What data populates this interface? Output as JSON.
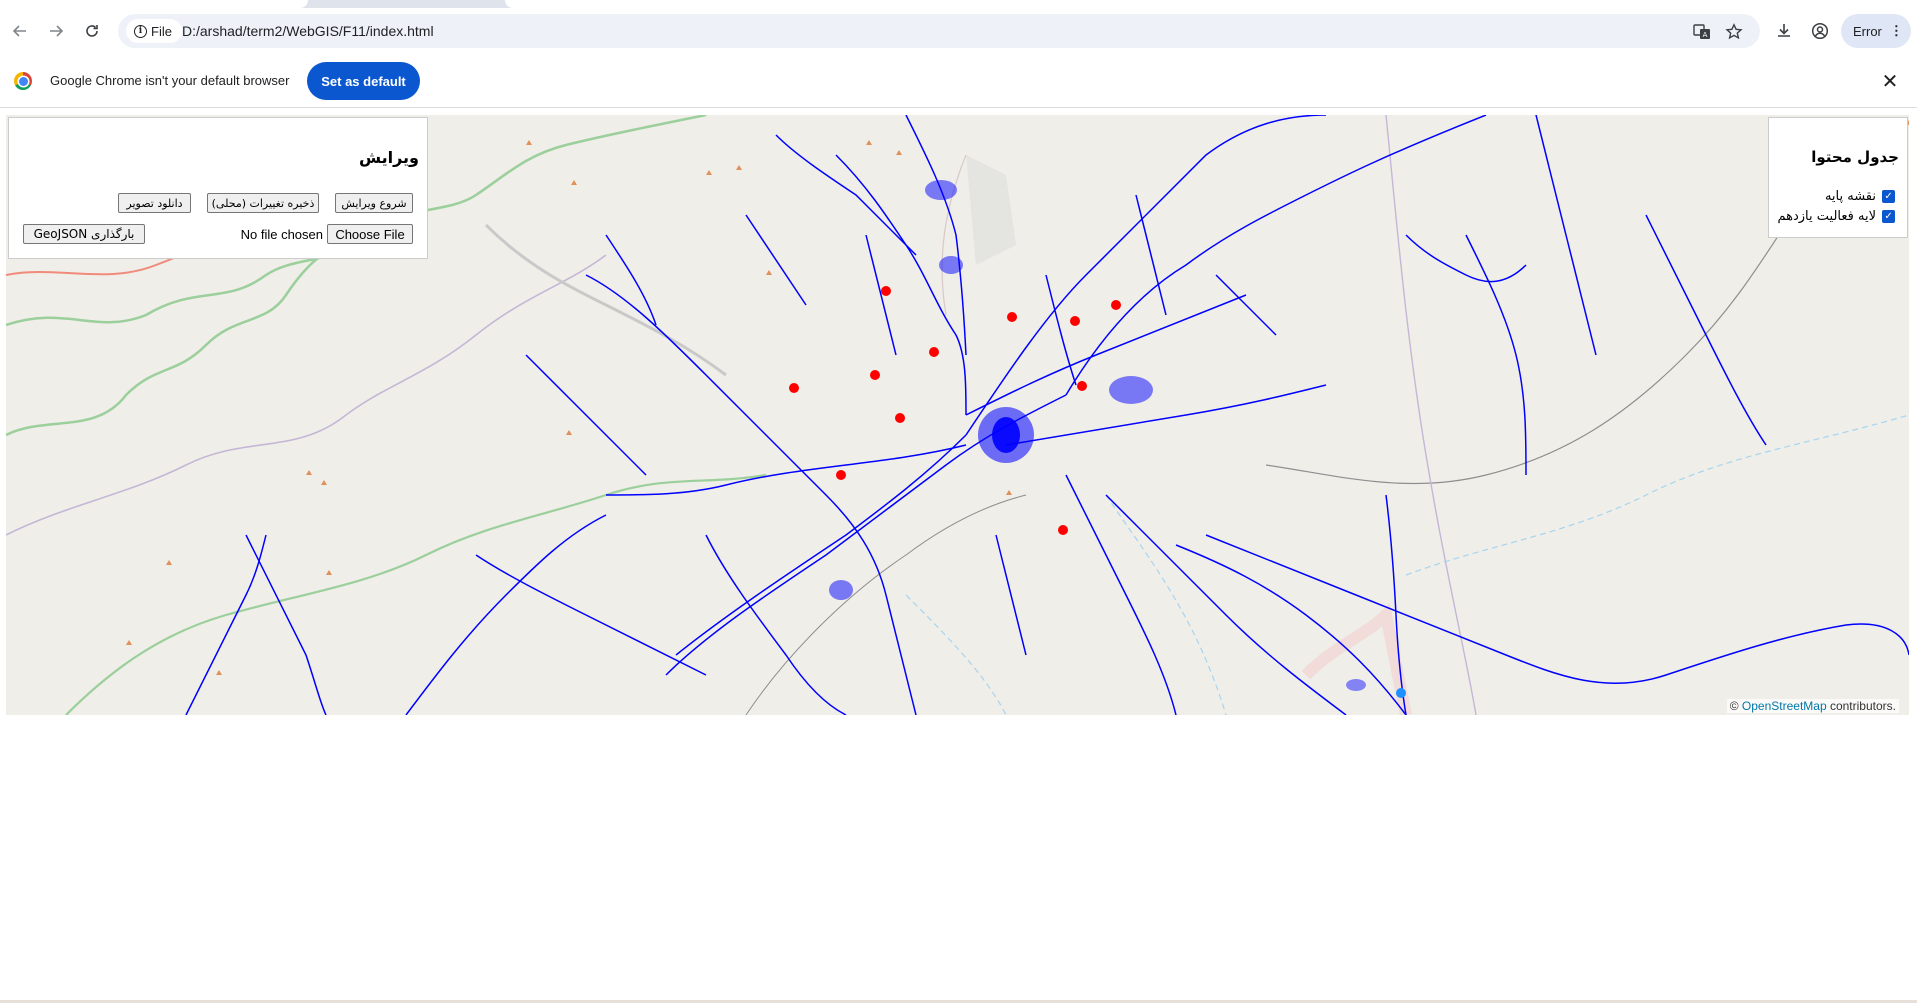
{
  "browser": {
    "site_info_label": "File",
    "url": "D:/arshad/term2/WebGIS/F11/index.html",
    "profile_status": "Error",
    "icons": {
      "back": "back-arrow-icon",
      "forward": "forward-arrow-icon",
      "reload": "reload-icon",
      "translate": "translate-icon",
      "bookmark": "star-icon",
      "download": "download-icon",
      "profile": "profile-icon",
      "menu": "kebab-menu-icon"
    }
  },
  "infobar": {
    "message": "Google Chrome isn't your default browser",
    "button_label": "Set as default"
  },
  "edit_panel": {
    "title": "ویرایش",
    "start_edit_label": "شروع ویرایش",
    "save_local_label": "ذخیره تغییرات (محلی)",
    "download_image_label": "دانلود تصویر",
    "choose_file_label": "Choose File",
    "no_file_label": "No file chosen",
    "upload_geojson_label": "بارگذاری GeoJSON"
  },
  "layer_panel": {
    "title": "جدول محتوا",
    "layers": [
      {
        "label": "نقشه پایه",
        "checked": true
      },
      {
        "label": "لایه فعالیت یازدهم",
        "checked": true
      }
    ]
  },
  "map": {
    "attribution_prefix": "© ",
    "attribution_link": "OpenStreetMap",
    "attribution_suffix": " contributors.",
    "road_color": "#0000ff",
    "point_color": "#ff0000",
    "location_color": "#1e90ff",
    "background_color": "#f0eee9"
  }
}
